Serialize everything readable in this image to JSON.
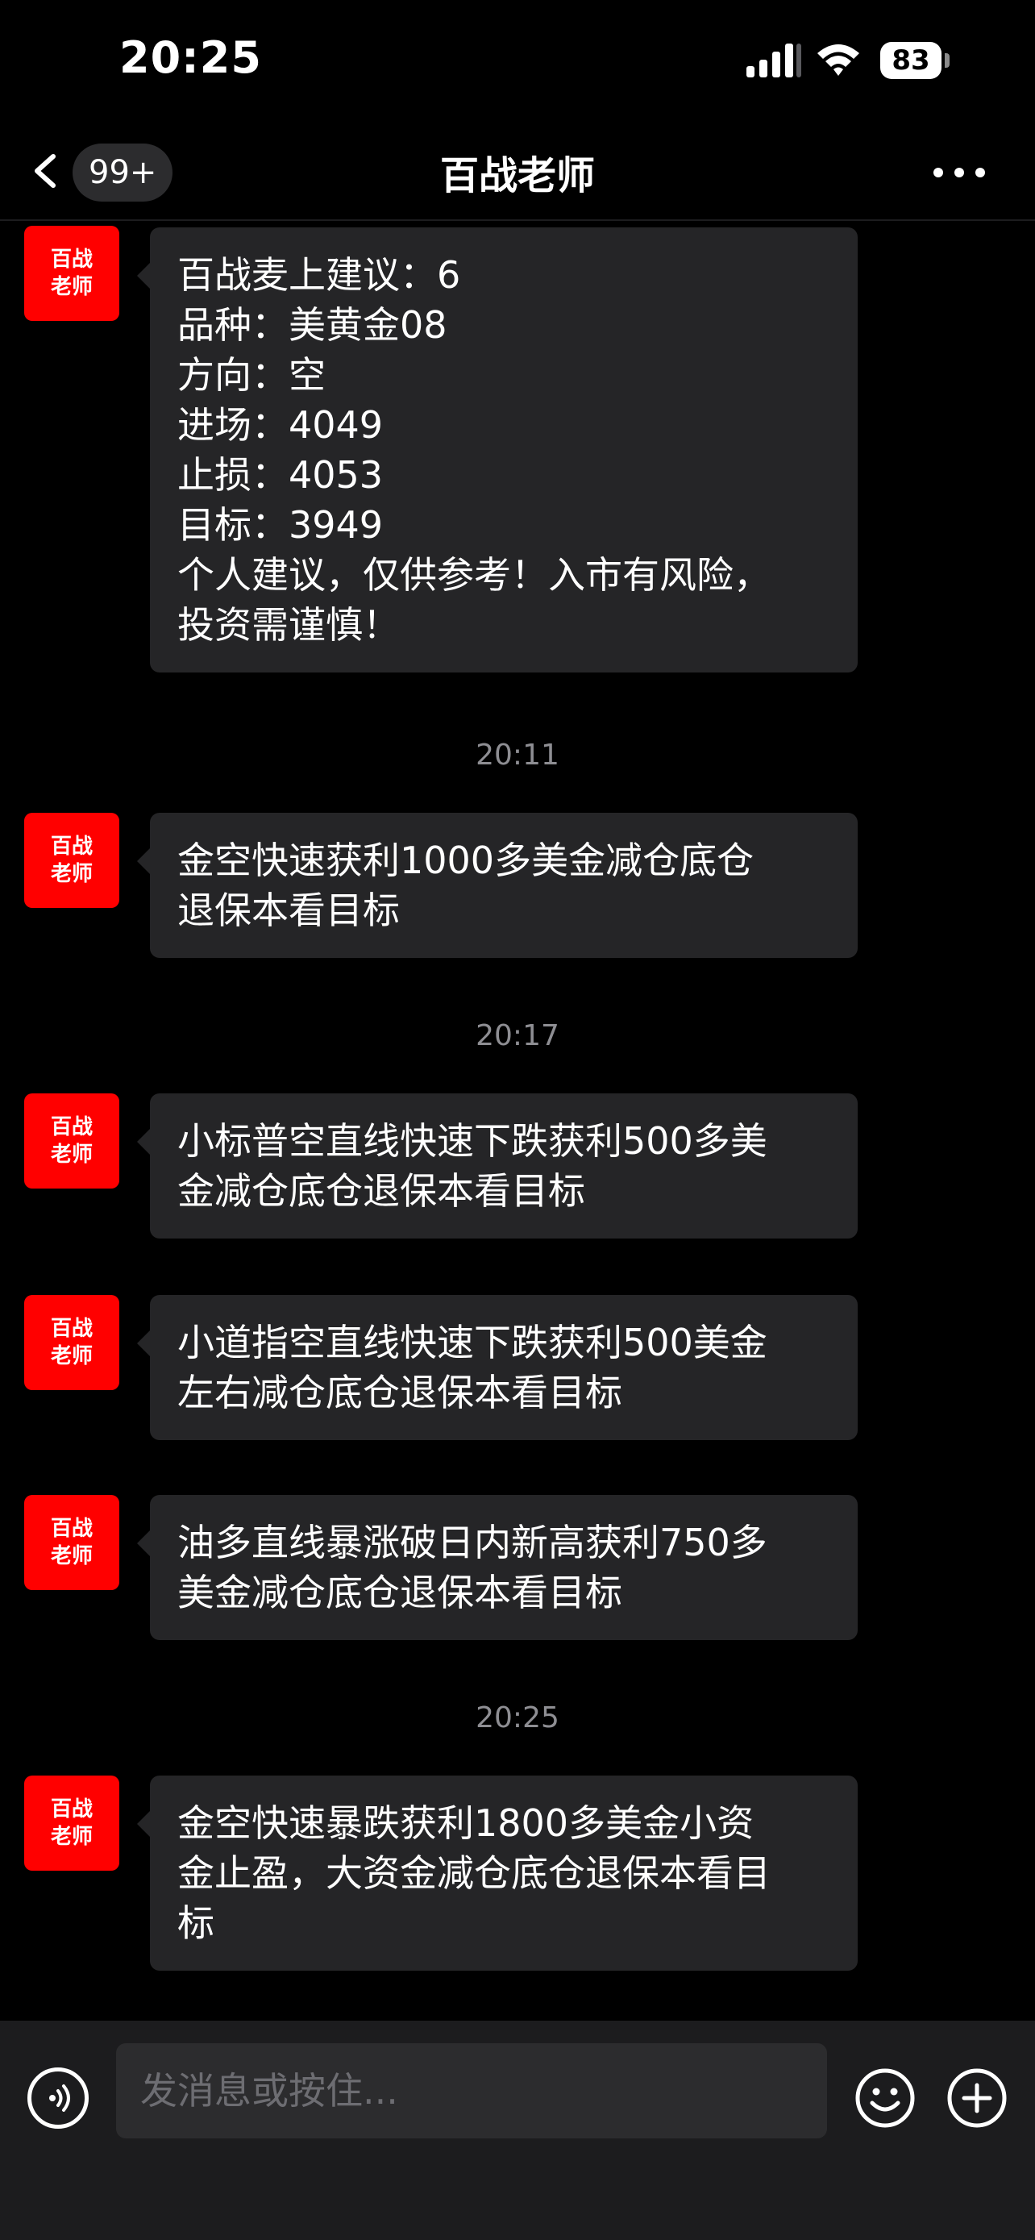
{
  "status_bar": {
    "time": "20:25",
    "battery": "83"
  },
  "nav": {
    "badge": "99+",
    "title": "百战老师",
    "back_icon": "chevron-left-icon",
    "more_icon": "ellipsis-icon"
  },
  "avatar_text": {
    "line1": "百战",
    "line2": "老师"
  },
  "messages": [
    {
      "lines": [
        "百战麦上建议：6",
        "品种：美黄金08",
        "方向：空",
        "进场：4049",
        "止损：4053",
        "目标：3949",
        "个人建议，仅供参考！入市有风险，",
        "投资需谨慎！"
      ]
    },
    {
      "lines": [
        "金空快速获利1000多美金减仓底仓",
        "退保本看目标"
      ]
    },
    {
      "lines": [
        "小标普空直线快速下跌获利500多美",
        "金减仓底仓退保本看目标"
      ]
    },
    {
      "lines": [
        "小道指空直线快速下跌获利500美金",
        "左右减仓底仓退保本看目标"
      ]
    },
    {
      "lines": [
        "油多直线暴涨破日内新高获利750多",
        "美金减仓底仓退保本看目标"
      ]
    },
    {
      "lines": [
        "金空快速暴跌获利1800多美金小资",
        "金止盈，大资金减仓底仓退保本看目",
        "标"
      ]
    }
  ],
  "timestamps": [
    "20:11",
    "20:17",
    "20:25"
  ],
  "input": {
    "placeholder": "发消息或按住..."
  },
  "colors": {
    "avatar_bg": "#ff0000",
    "bubble_bg": "#252527",
    "background": "#000000"
  }
}
